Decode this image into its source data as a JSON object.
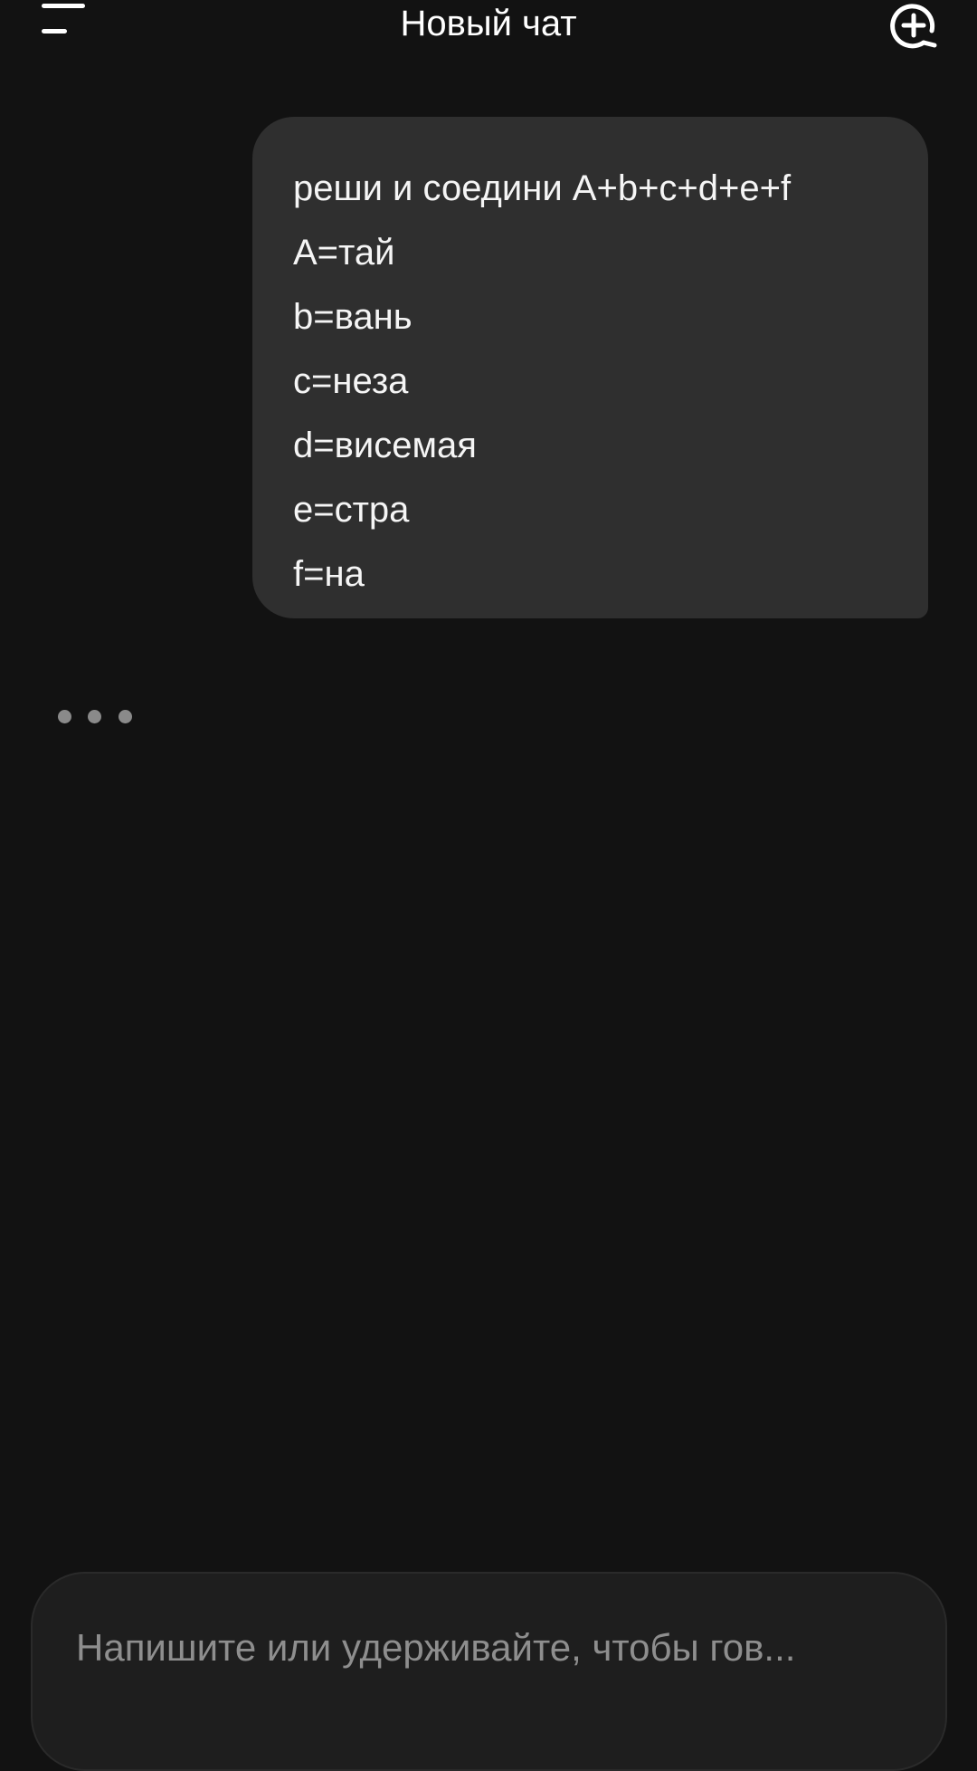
{
  "header": {
    "title": "Новый чат",
    "menu_icon": "menu-icon",
    "new_chat_icon": "new-chat-plus-icon"
  },
  "message": {
    "lines": [
      "реши и соедини A+b+c+d+e+f",
      "A=тай",
      "b=вань",
      "c=неза",
      "d=висемая",
      "e=стра",
      "f=на"
    ]
  },
  "typing_indicator": {
    "state": "typing",
    "dot_color": "#8a8a8a"
  },
  "composer": {
    "placeholder": "Напишите или удерживайте, чтобы гов...",
    "value": ""
  },
  "colors": {
    "background": "#121212",
    "bubble": "#2f2f2f",
    "text": "#ffffff",
    "placeholder": "#8e8e8e",
    "composer": "#1e1e1e"
  }
}
